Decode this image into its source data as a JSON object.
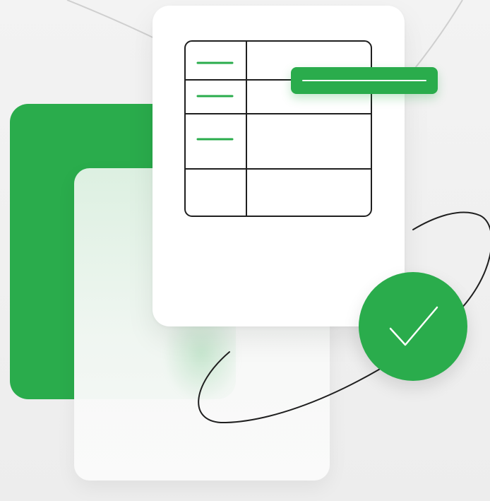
{
  "illustration": {
    "subject": "document-table-approved",
    "colors": {
      "background": "#efefef",
      "accent_green": "#2aac4c",
      "card_white": "#ffffff",
      "line_dark": "#1f1f1f",
      "decor_line": "#cfcfcf"
    },
    "icons": {
      "table": "table-icon",
      "check": "checkmark-icon",
      "highlight": "highlight-bar"
    },
    "table": {
      "rows": 4,
      "columns": 2,
      "marked_rows": 3
    }
  }
}
